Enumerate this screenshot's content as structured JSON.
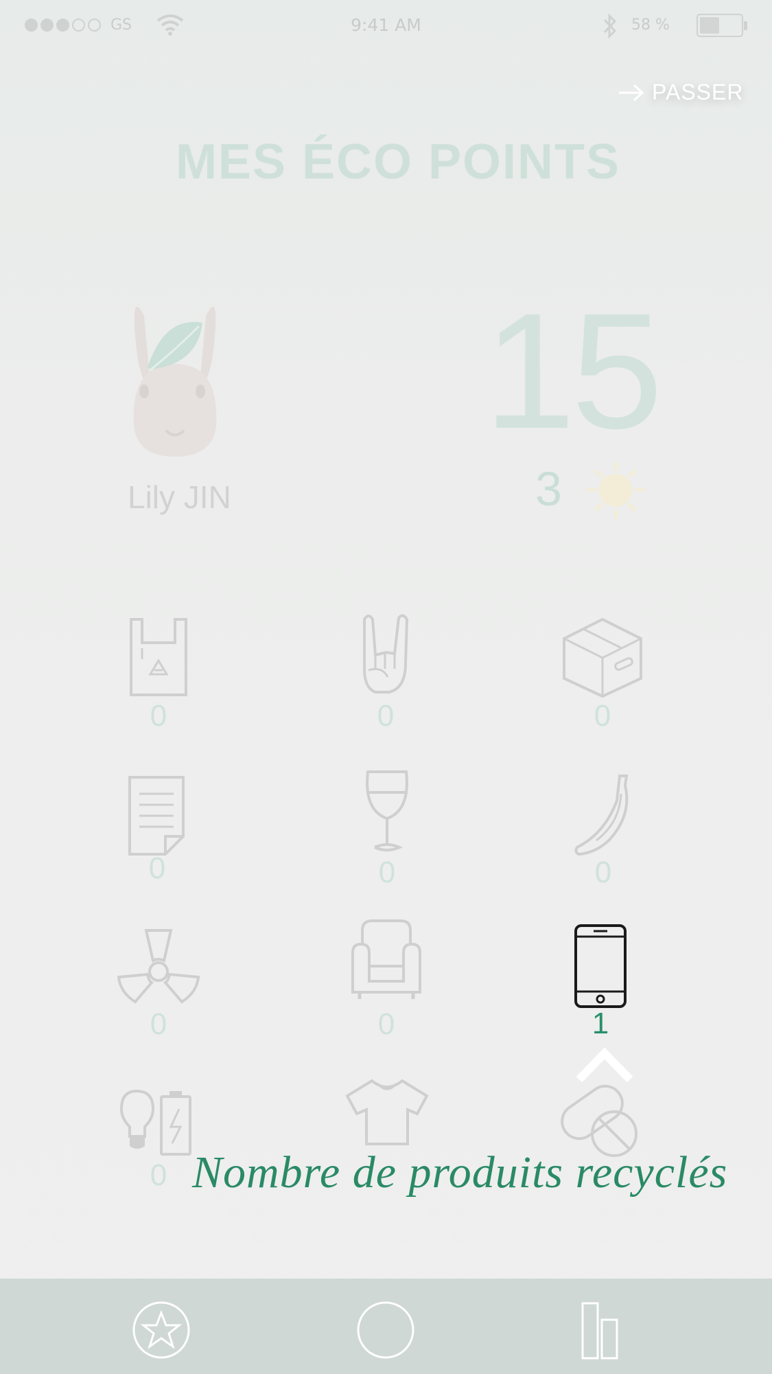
{
  "status_bar": {
    "carrier": "GS",
    "time": "9:41 AM",
    "battery": "58 %",
    "battery_level": 0.58,
    "signal_bars_filled": 3,
    "signal_bars_total": 5
  },
  "header": {
    "skip_label": "PASSER",
    "title": "MES ÉCO POINTS"
  },
  "profile": {
    "name": "Lily JIN",
    "points": "15",
    "level": "3"
  },
  "categories": [
    {
      "icon": "recycle-bag-icon",
      "count": "0"
    },
    {
      "icon": "rock-hand-icon",
      "count": "0"
    },
    {
      "icon": "cardboard-box-icon",
      "count": "0"
    },
    {
      "icon": "paper-document-icon",
      "count": "0"
    },
    {
      "icon": "wine-glass-icon",
      "count": "0"
    },
    {
      "icon": "banana-icon",
      "count": "0"
    },
    {
      "icon": "radioactive-icon",
      "count": "0"
    },
    {
      "icon": "armchair-icon",
      "count": "0"
    },
    {
      "icon": "smartphone-icon",
      "count": "1"
    },
    {
      "icon": "bulb-battery-icon",
      "count": "0"
    },
    {
      "icon": "tshirt-icon",
      "count": "0"
    },
    {
      "icon": "pills-icon",
      "count": "0"
    }
  ],
  "tooltip": {
    "caption": "Nombre de produits recyclés"
  },
  "tab_bar": {
    "items": [
      "star-icon",
      "circle-icon",
      "bar-chart-icon"
    ]
  },
  "colors": {
    "accent": "#2a8a66",
    "title_faded": "#cfe0da",
    "tab_bar": "#cfd8d5"
  }
}
